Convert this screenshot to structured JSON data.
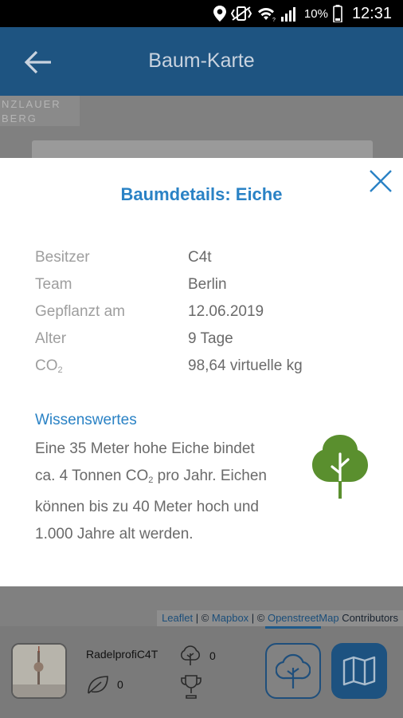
{
  "status_bar": {
    "battery_percent": "10%",
    "time": "12:31"
  },
  "app_bar": {
    "title": "Baum-Karte"
  },
  "map": {
    "district_label_line1": "NZLAUER",
    "district_label_line2": "BERG",
    "attribution": {
      "leaflet": "Leaflet",
      "sep1": " | © ",
      "mapbox": "Mapbox",
      "sep2": " | © ",
      "osm": "OpenstreetMap",
      "contributors": " Contributors"
    }
  },
  "modal": {
    "title": "Baumdetails: Eiche",
    "details": [
      {
        "label": "Besitzer",
        "value": "C4t"
      },
      {
        "label": "Team",
        "value": "Berlin"
      },
      {
        "label": "Gepflanzt am",
        "value": "12.06.2019"
      },
      {
        "label": "Alter",
        "value": "9 Tage"
      },
      {
        "label": "CO",
        "label_sub": "2",
        "value": "98,64 virtuelle kg"
      }
    ],
    "section_title": "Wissenswertes",
    "fact_part1": "Eine 35 Meter hohe Eiche bindet ca. 4 Tonnen CO",
    "fact_sub": "2",
    "fact_part2": " pro Jahr. Eichen können bis zu 40 Meter hoch und 1.000 Jahre alt werden.",
    "tree_icon": "tree-icon",
    "accent_color": "#2a82c5",
    "tree_color": "#5a8f2e"
  },
  "bottom_bar": {
    "username": "RadelprofiC4T",
    "trees_count": "0",
    "leaf_count": "0"
  },
  "colors": {
    "app_bar": "#1e5481",
    "overlay": "#808080"
  }
}
